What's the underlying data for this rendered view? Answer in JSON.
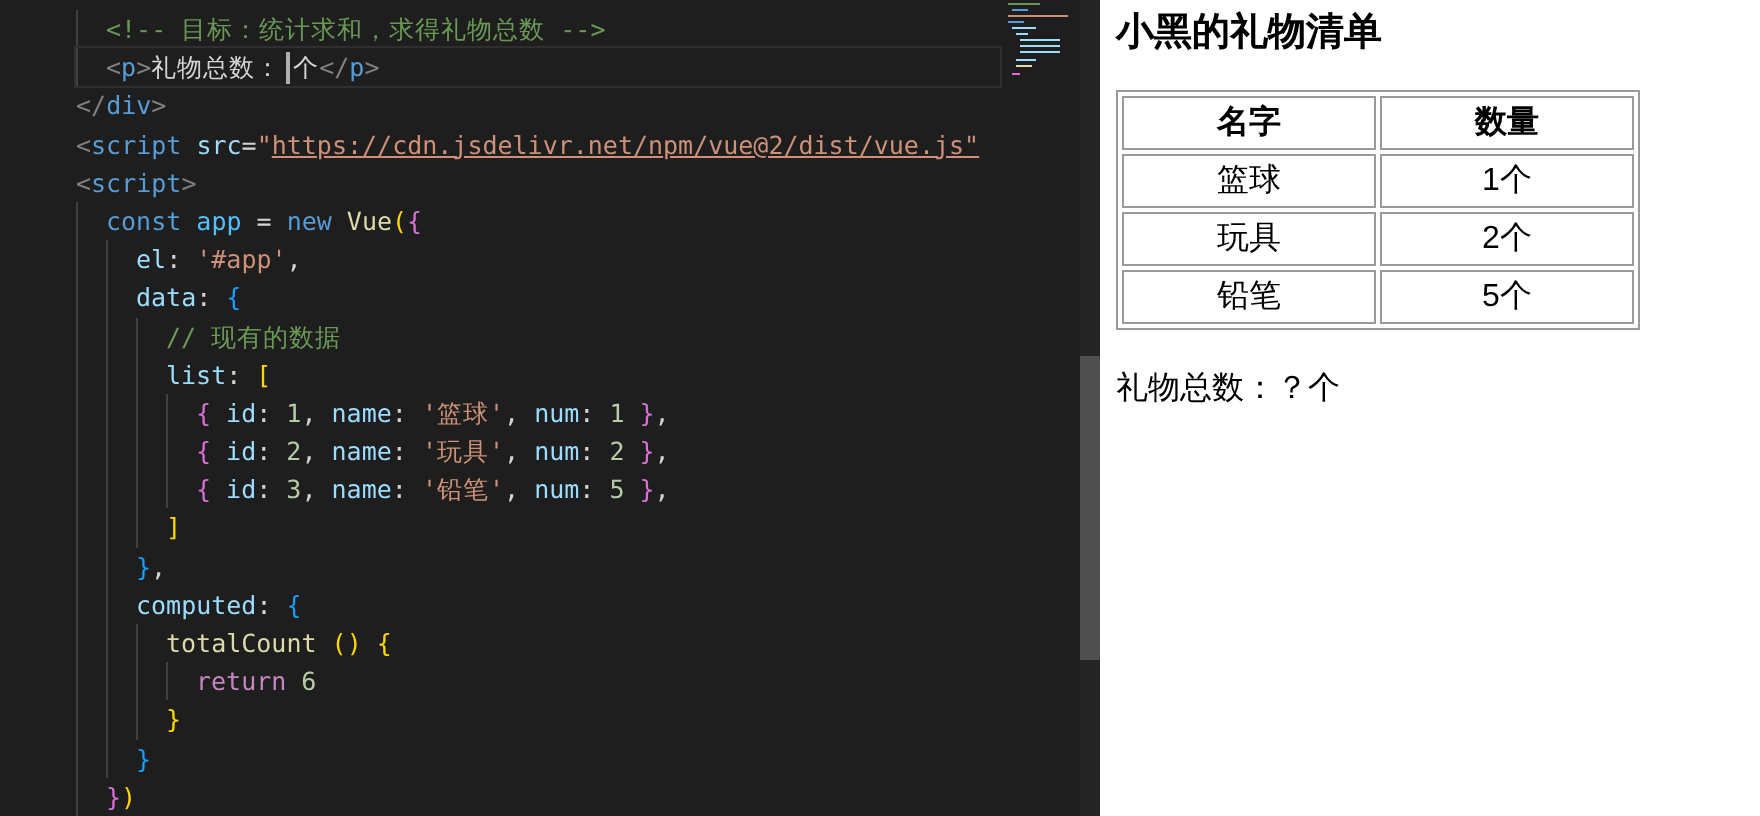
{
  "editor": {
    "lines": [
      [
        {
          "kind": "comment",
          "text": "  <!-- 目标：统计求和，求得礼物总数 -->"
        }
      ],
      [
        {
          "kind": "punct",
          "text": "  <"
        },
        {
          "kind": "tag",
          "text": "p"
        },
        {
          "kind": "punct",
          "text": ">"
        },
        {
          "kind": "text",
          "text": "礼物总数："
        },
        {
          "kind": "caret"
        },
        {
          "kind": "text",
          "text": "个"
        },
        {
          "kind": "punct",
          "text": "</"
        },
        {
          "kind": "tag",
          "text": "p"
        },
        {
          "kind": "punct",
          "text": ">"
        }
      ],
      [
        {
          "kind": "punct",
          "text": "</"
        },
        {
          "kind": "tag",
          "text": "div"
        },
        {
          "kind": "punct",
          "text": ">"
        }
      ],
      [
        {
          "kind": "punct",
          "text": "<"
        },
        {
          "kind": "tag",
          "text": "script"
        },
        {
          "kind": "attr",
          "text": " src"
        },
        {
          "kind": "text",
          "text": "="
        },
        {
          "kind": "str",
          "text": "\""
        },
        {
          "kind": "url",
          "text": "https://cdn.jsdelivr.net/npm/vue@2/dist/vue.js\""
        }
      ],
      [
        {
          "kind": "punct",
          "text": "<"
        },
        {
          "kind": "tag",
          "text": "script"
        },
        {
          "kind": "punct",
          "text": ">"
        }
      ],
      [
        {
          "kind": "kw",
          "text": "  const"
        },
        {
          "kind": "var",
          "text": " app"
        },
        {
          "kind": "text",
          "text": " = "
        },
        {
          "kind": "kw",
          "text": "new"
        },
        {
          "kind": "cls",
          "text": " Vue"
        },
        {
          "kind": "b1",
          "text": "("
        },
        {
          "kind": "b2",
          "text": "{"
        }
      ],
      [
        {
          "kind": "prop",
          "text": "    el"
        },
        {
          "kind": "text",
          "text": ": "
        },
        {
          "kind": "str",
          "text": "'#app'"
        },
        {
          "kind": "text",
          "text": ","
        }
      ],
      [
        {
          "kind": "prop",
          "text": "    data"
        },
        {
          "kind": "text",
          "text": ": "
        },
        {
          "kind": "b3",
          "text": "{"
        }
      ],
      [
        {
          "kind": "comment",
          "text": "      // 现有的数据"
        }
      ],
      [
        {
          "kind": "prop",
          "text": "      list"
        },
        {
          "kind": "text",
          "text": ": "
        },
        {
          "kind": "b1",
          "text": "["
        }
      ],
      [
        {
          "kind": "b2",
          "text": "        {"
        },
        {
          "kind": "prop",
          "text": " id"
        },
        {
          "kind": "text",
          "text": ": "
        },
        {
          "kind": "num",
          "text": "1"
        },
        {
          "kind": "text",
          "text": ", "
        },
        {
          "kind": "prop",
          "text": "name"
        },
        {
          "kind": "text",
          "text": ": "
        },
        {
          "kind": "str",
          "text": "'篮球'"
        },
        {
          "kind": "text",
          "text": ", "
        },
        {
          "kind": "prop",
          "text": "num"
        },
        {
          "kind": "text",
          "text": ": "
        },
        {
          "kind": "num",
          "text": "1"
        },
        {
          "kind": "b2",
          "text": " }"
        },
        {
          "kind": "text",
          "text": ","
        }
      ],
      [
        {
          "kind": "b2",
          "text": "        {"
        },
        {
          "kind": "prop",
          "text": " id"
        },
        {
          "kind": "text",
          "text": ": "
        },
        {
          "kind": "num",
          "text": "2"
        },
        {
          "kind": "text",
          "text": ", "
        },
        {
          "kind": "prop",
          "text": "name"
        },
        {
          "kind": "text",
          "text": ": "
        },
        {
          "kind": "str",
          "text": "'玩具'"
        },
        {
          "kind": "text",
          "text": ", "
        },
        {
          "kind": "prop",
          "text": "num"
        },
        {
          "kind": "text",
          "text": ": "
        },
        {
          "kind": "num",
          "text": "2"
        },
        {
          "kind": "b2",
          "text": " }"
        },
        {
          "kind": "text",
          "text": ","
        }
      ],
      [
        {
          "kind": "b2",
          "text": "        {"
        },
        {
          "kind": "prop",
          "text": " id"
        },
        {
          "kind": "text",
          "text": ": "
        },
        {
          "kind": "num",
          "text": "3"
        },
        {
          "kind": "text",
          "text": ", "
        },
        {
          "kind": "prop",
          "text": "name"
        },
        {
          "kind": "text",
          "text": ": "
        },
        {
          "kind": "str",
          "text": "'铅笔'"
        },
        {
          "kind": "text",
          "text": ", "
        },
        {
          "kind": "prop",
          "text": "num"
        },
        {
          "kind": "text",
          "text": ": "
        },
        {
          "kind": "num",
          "text": "5"
        },
        {
          "kind": "b2",
          "text": " }"
        },
        {
          "kind": "text",
          "text": ","
        }
      ],
      [
        {
          "kind": "b1",
          "text": "      ]"
        }
      ],
      [
        {
          "kind": "b3",
          "text": "    }"
        },
        {
          "kind": "text",
          "text": ","
        }
      ],
      [
        {
          "kind": "prop",
          "text": "    computed"
        },
        {
          "kind": "text",
          "text": ": "
        },
        {
          "kind": "b3",
          "text": "{"
        }
      ],
      [
        {
          "kind": "fn",
          "text": "      totalCount"
        },
        {
          "kind": "b1",
          "text": " ()"
        },
        {
          "kind": "b1",
          "text": " {"
        }
      ],
      [
        {
          "kind": "ctrl",
          "text": "        return"
        },
        {
          "kind": "num",
          "text": " 6"
        }
      ],
      [
        {
          "kind": "b1",
          "text": "      }"
        }
      ],
      [
        {
          "kind": "b3",
          "text": "    }"
        }
      ],
      [
        {
          "kind": "b2",
          "text": "  }"
        },
        {
          "kind": "b1",
          "text": ")"
        }
      ]
    ]
  },
  "preview": {
    "title": "小黑的礼物清单",
    "table": {
      "columns": [
        "名字",
        "数量"
      ],
      "rows": [
        [
          "篮球",
          "1个"
        ],
        [
          "玩具",
          "2个"
        ],
        [
          "铅笔",
          "5个"
        ]
      ]
    },
    "total": "礼物总数：？个"
  }
}
